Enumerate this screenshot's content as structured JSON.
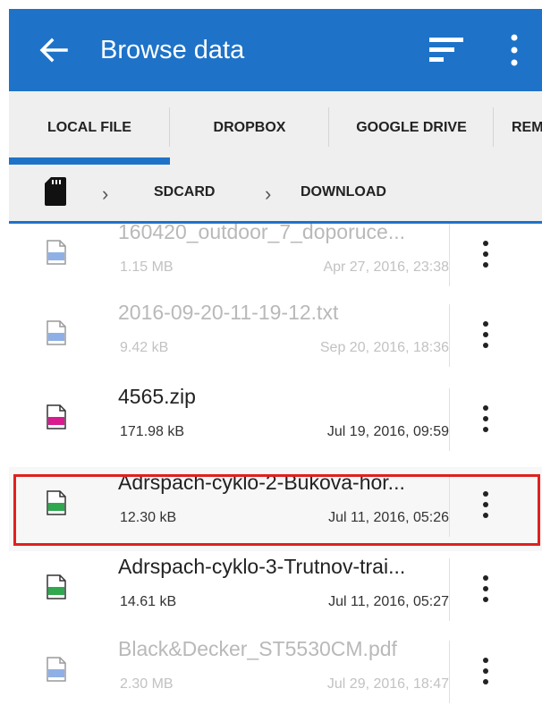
{
  "appbar": {
    "title": "Browse data",
    "bg_color": "#1e73c8"
  },
  "tabs": [
    {
      "label": "LOCAL FILE",
      "active": true
    },
    {
      "label": "DROPBOX",
      "active": false
    },
    {
      "label": "GOOGLE DRIVE",
      "active": false
    },
    {
      "label": "REM",
      "active": false
    }
  ],
  "breadcrumb": [
    {
      "label": "SDCARD"
    },
    {
      "label": "DOWNLOAD"
    }
  ],
  "files": [
    {
      "name": "160420_outdoor_7_doporuce...",
      "size": "1.15 MB",
      "date": "Apr 27, 2016, 23:38",
      "type": "PDF",
      "type_color": "#4a7fd4",
      "enabled": false
    },
    {
      "name": "2016-09-20-11-19-12.txt",
      "size": "9.42 kB",
      "date": "Sep 20, 2016, 18:36",
      "type": "TXT",
      "type_color": "#4a7fd4",
      "enabled": false
    },
    {
      "name": "4565.zip",
      "size": "171.98 kB",
      "date": "Jul 19, 2016, 09:59",
      "type": "ZIP",
      "type_color": "#d81b8f",
      "enabled": true
    },
    {
      "name": "Adrspach-cyklo-2-Bukova-hor...",
      "size": "12.30 kB",
      "date": "Jul 11, 2016, 05:26",
      "type": "GPX",
      "type_color": "#2fa84f",
      "enabled": true,
      "highlighted": true
    },
    {
      "name": "Adrspach-cyklo-3-Trutnov-trai...",
      "size": "14.61 kB",
      "date": "Jul 11, 2016, 05:27",
      "type": "GPX",
      "type_color": "#2fa84f",
      "enabled": true
    },
    {
      "name": "Black&Decker_ST5530CM.pdf",
      "size": "2.30 MB",
      "date": "Jul 29, 2016, 18:47",
      "type": "PDF",
      "type_color": "#4a7fd4",
      "enabled": false
    }
  ],
  "highlight_color": "#e02020"
}
